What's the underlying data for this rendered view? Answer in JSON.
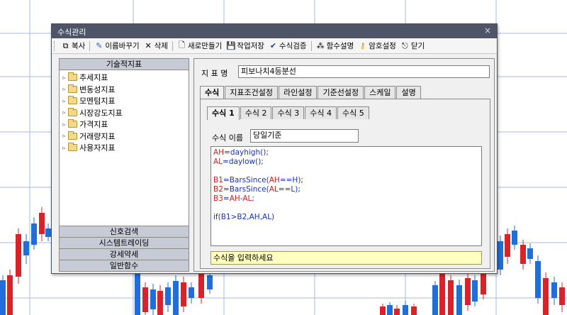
{
  "dialog": {
    "title": "수식관리",
    "close_label": "×"
  },
  "toolbar": {
    "copy": "복사",
    "rename": "이름바꾸기",
    "delete": "삭제",
    "new": "새로만들기",
    "save": "작업저장",
    "verify": "수식검증",
    "func_help": "함수설명",
    "password": "암호설정",
    "close": "닫기"
  },
  "left": {
    "header": "기술적지표",
    "tree": [
      "추세지표",
      "변동성지표",
      "모멘텀지표",
      "시장강도지표",
      "가격지표",
      "거래량지표",
      "사용자지표"
    ],
    "bottom_tabs": [
      "신호검색",
      "시스템트레이딩",
      "강세약세",
      "일반함수"
    ]
  },
  "right": {
    "indicator_label": "지 표 명",
    "indicator_name": "피보나치4등분선",
    "tabs": [
      "수식",
      "지표조건설정",
      "라인설정",
      "기준선설정",
      "스케일",
      "설명"
    ],
    "formula_tabs": [
      "수식 1",
      "수식 2",
      "수식 3",
      "수식 4",
      "수식 5"
    ],
    "formula_name_label": "수식 이름",
    "formula_name": "당일기준",
    "hint": "수식을 입력하세요"
  },
  "code": {
    "line1a": "AH",
    "line1b": "=",
    "line1c": "dayhigh",
    "line1d": "();",
    "line2a": "AL",
    "line2b": "=",
    "line2c": "daylow",
    "line2d": "();",
    "line3a": "B1",
    "line3b": "=",
    "line3c": "BarsSince",
    "line3d": "(",
    "line3e": "AH",
    "line3f": "==",
    "line3g": "H",
    "line3h": ");",
    "line4a": "B2",
    "line4b": "=",
    "line4c": "BarsSince",
    "line4d": "(",
    "line4e": "AL",
    "line4f": "==",
    "line4g": "L",
    "line4h": ");",
    "line5a": "B3",
    "line5b": "=",
    "line5c": "AH",
    "line5d": "-",
    "line5e": "AL",
    "line5f": ";",
    "line6": "if(B1>B2,AH,AL)"
  },
  "colors": {
    "candle_up": "#d9232a",
    "candle_down": "#1e6fd9",
    "grid": "#a9b8e8"
  }
}
